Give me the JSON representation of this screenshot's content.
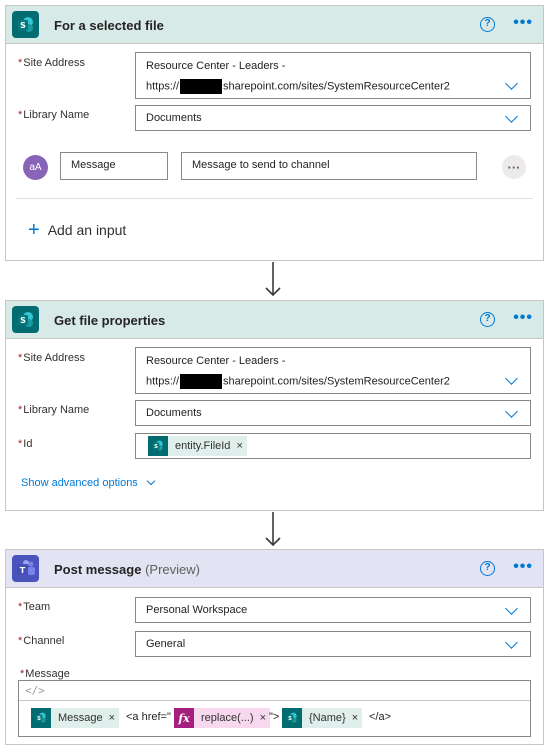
{
  "card1": {
    "title": "For a selected file",
    "help_icon": "?",
    "more_icon": "•••",
    "site_address_label": "Site Address",
    "site_address_line1": "Resource Center - Leaders -",
    "site_address_prefix": "https://",
    "site_address_suffix": "sharepoint.com/sites/SystemResourceCenter2",
    "library_label": "Library Name",
    "library_value": "Documents",
    "input_avatar": "aA",
    "input_name": "Message",
    "input_description": "Message to send to channel",
    "input_more": "···",
    "add_input_icon": "+",
    "add_input_label": "Add an input"
  },
  "card2": {
    "title": "Get file properties",
    "help_icon": "?",
    "more_icon": "•••",
    "site_address_label": "Site Address",
    "site_address_line1": "Resource Center - Leaders -",
    "site_address_prefix": "https://",
    "site_address_suffix": "sharepoint.com/sites/SystemResourceCenter2",
    "library_label": "Library Name",
    "library_value": "Documents",
    "id_label": "Id",
    "id_token": "entity.FileId",
    "token_remove": "×",
    "advanced_label": "Show advanced options"
  },
  "card3": {
    "title": "Post message",
    "title_suffix": "(Preview)",
    "help_icon": "?",
    "more_icon": "•••",
    "team_label": "Team",
    "team_value": "Personal Workspace",
    "channel_label": "Channel",
    "channel_value": "General",
    "message_label": "Message",
    "code_icon": "</>",
    "token_message": "Message",
    "text_href_open": "<a href=\"",
    "fx_label": "fx",
    "token_replace": "replace(...)",
    "text_href_close": "\">",
    "token_name": "{Name}",
    "text_a_close": "</a>",
    "token_remove": "×"
  },
  "required_marker": "*",
  "colors": {
    "sharepoint": "#036c70",
    "teams": "#4b53bc",
    "accent": "#0078d4",
    "required": "#a4262c",
    "expression": "#a5207e"
  },
  "icons": [
    "sharepoint-icon",
    "teams-icon",
    "help-icon",
    "more-icon",
    "chevron-down-icon",
    "add-icon",
    "arrow-down-icon",
    "code-icon",
    "fx-icon"
  ]
}
